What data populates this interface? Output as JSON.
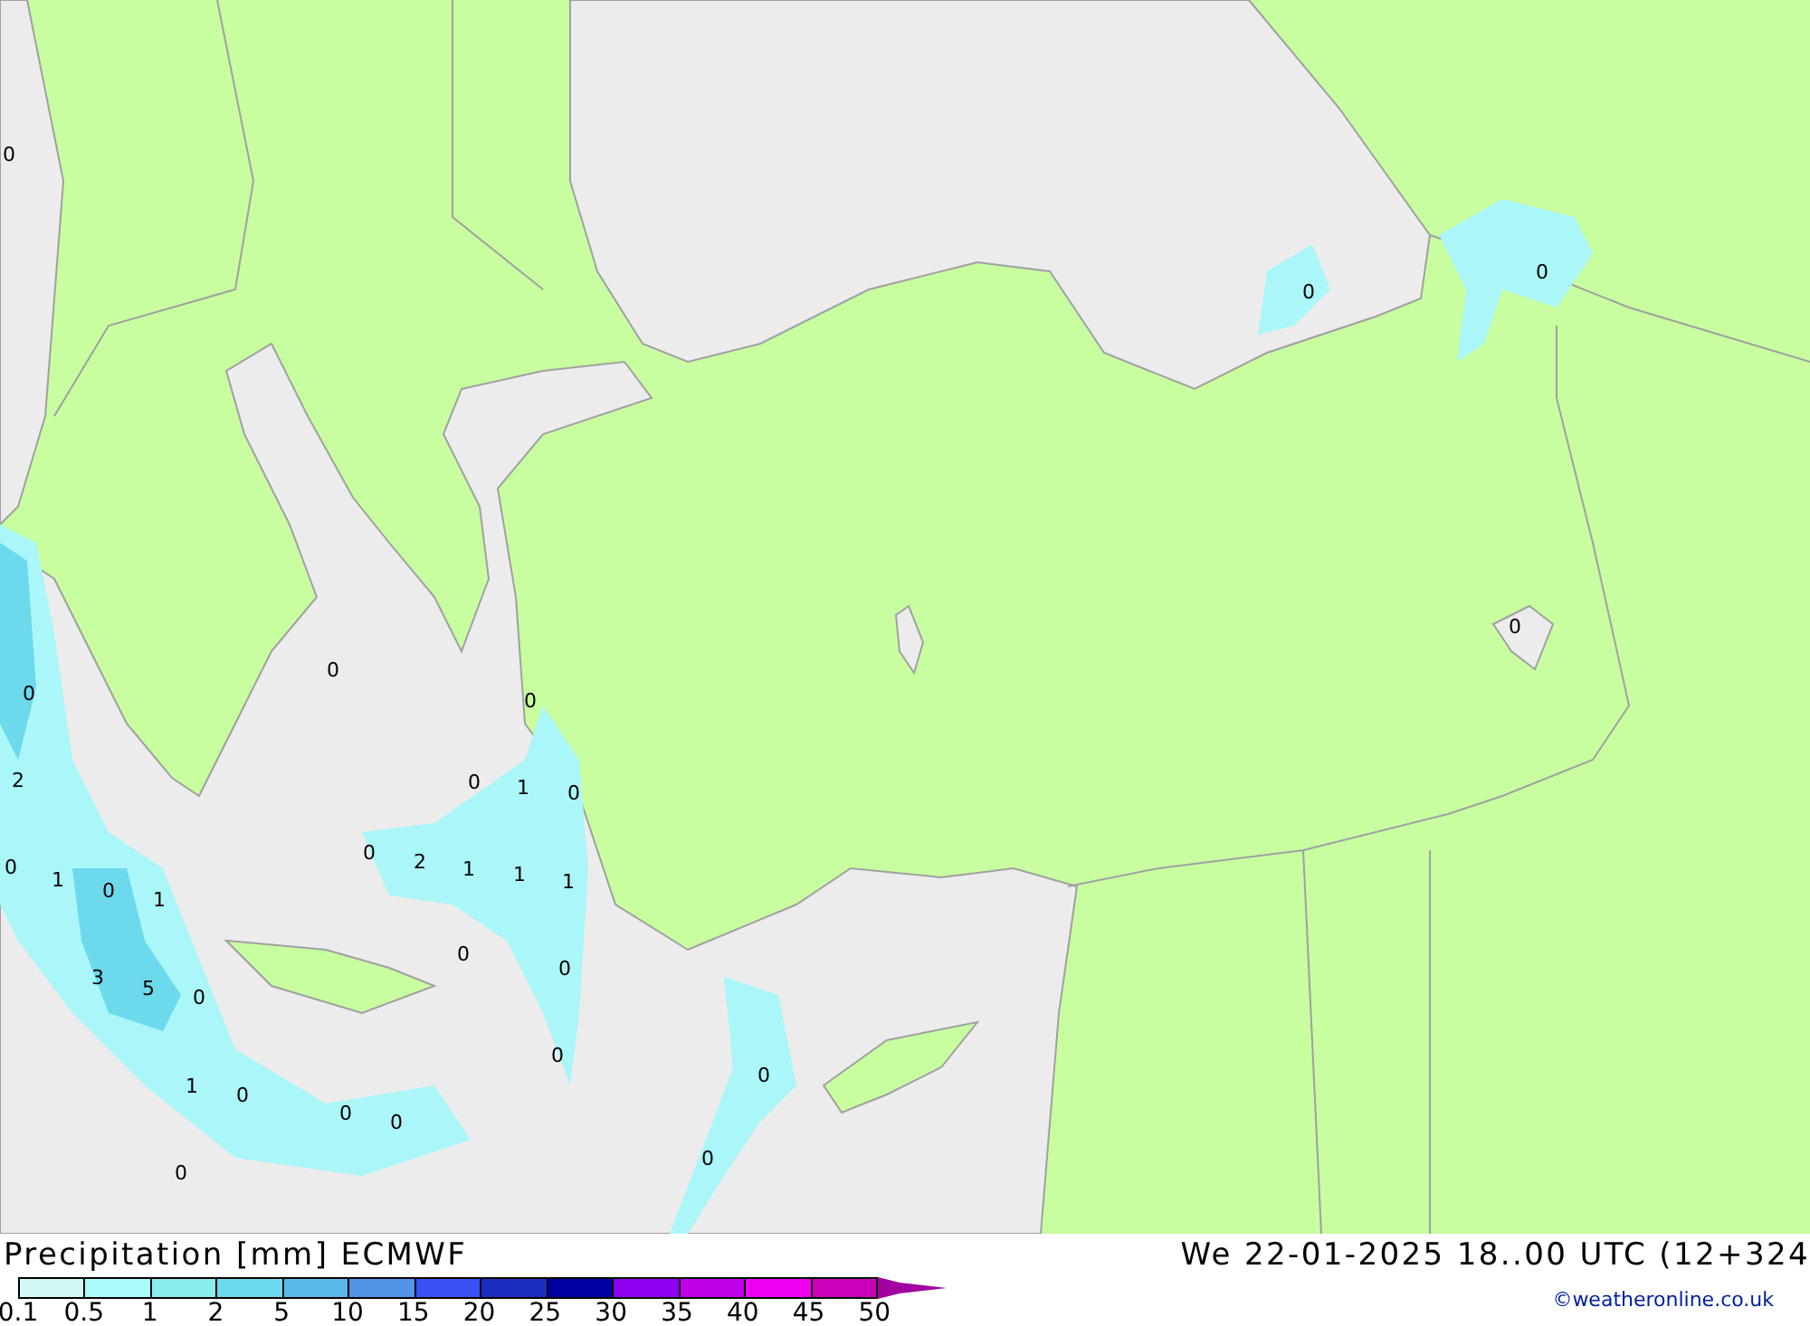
{
  "map": {
    "value_labels": [
      "0",
      "0",
      "0",
      "0",
      "0",
      "0",
      "0",
      "2",
      "0",
      "1",
      "0",
      "0",
      "1",
      "0",
      "1",
      "0",
      "2",
      "1",
      "1",
      "1",
      "0",
      "0",
      "3",
      "5",
      "0",
      "0",
      "0",
      "1",
      "0",
      "0",
      "0",
      "0",
      "0"
    ]
  },
  "legend": {
    "title": "Precipitation [mm] ECMWF",
    "bins": [
      {
        "color": "#d2f7f5"
      },
      {
        "color": "#aafcfc"
      },
      {
        "color": "#8aeceb"
      },
      {
        "color": "#6cd9ec"
      },
      {
        "color": "#5ab8ea"
      },
      {
        "color": "#5294e8"
      },
      {
        "color": "#3a50f5"
      },
      {
        "color": "#1c2ec0"
      },
      {
        "color": "#0000a0"
      },
      {
        "color": "#9000f0"
      },
      {
        "color": "#c000e8"
      },
      {
        "color": "#f000f0"
      },
      {
        "color": "#c800b8"
      }
    ],
    "ticks": [
      "0.1",
      "0.5",
      "1",
      "2",
      "5",
      "10",
      "15",
      "20",
      "25",
      "30",
      "35",
      "40",
      "45",
      "50"
    ]
  },
  "valid_time": "We 22-01-2025 18..00 UTC (12+324",
  "credit": "©weatheronline.co.uk"
}
